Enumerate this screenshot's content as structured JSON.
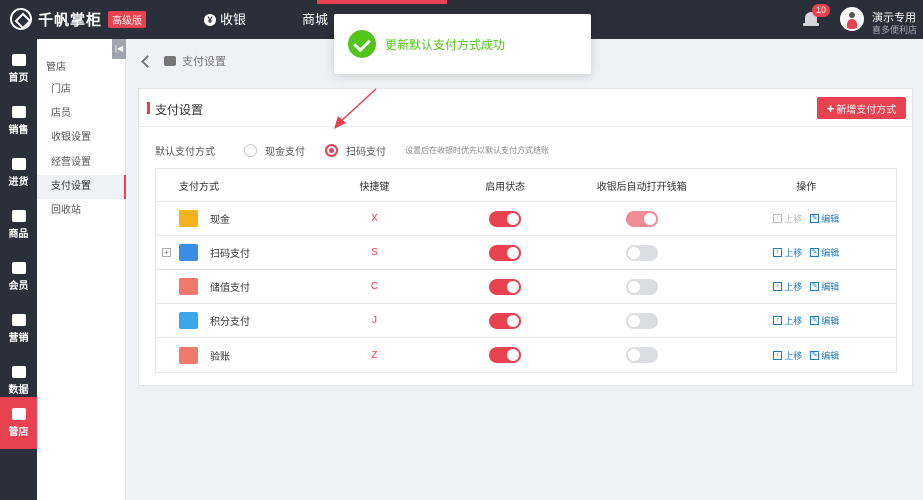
{
  "header": {
    "brand": "千帆掌柜",
    "edition": "高级版",
    "nav": [
      {
        "label": "收银",
        "icon": "yen-icon"
      },
      {
        "label": "商城"
      }
    ],
    "notification_count": "10",
    "user_name": "演示专用",
    "user_store": "喜多便利店"
  },
  "sidebar": {
    "items": [
      {
        "label": "首页"
      },
      {
        "label": "销售"
      },
      {
        "label": "进货"
      },
      {
        "label": "商品"
      },
      {
        "label": "会员"
      },
      {
        "label": "营销"
      },
      {
        "label": "数据"
      },
      {
        "label": "管店"
      }
    ]
  },
  "submenu": {
    "title": "管店",
    "items": [
      "门店",
      "店员",
      "收银设置",
      "经营设置",
      "支付设置",
      "回收站"
    ]
  },
  "breadcrumb": {
    "text": "支付设置"
  },
  "toast": {
    "message": "更新默认支付方式成功"
  },
  "panel": {
    "title": "支付设置",
    "add_button": "新增支付方式",
    "default_label": "默认支付方式",
    "options": [
      "现金支付",
      "扫码支付"
    ],
    "selected_option": "扫码支付",
    "hint": "设置后在收银时优先以默认支付方式结账"
  },
  "table": {
    "headers": [
      "支付方式",
      "快捷键",
      "启用状态",
      "收银后自动打开钱箱",
      "操作"
    ],
    "rows": [
      {
        "name": "现金",
        "key": "X",
        "enabled": true,
        "drawer": true,
        "up": "上移",
        "edit": "编辑",
        "up_disabled": true,
        "icon_color": "#f5b01a"
      },
      {
        "name": "扫码支付",
        "key": "S",
        "enabled": true,
        "drawer": false,
        "up": "上移",
        "edit": "编辑",
        "up_disabled": false,
        "icon_color": "#3a8ee6"
      },
      {
        "name": "储值支付",
        "key": "C",
        "enabled": true,
        "drawer": false,
        "up": "上移",
        "edit": "编辑",
        "up_disabled": false,
        "icon_color": "#f07a6a"
      },
      {
        "name": "积分支付",
        "key": "J",
        "enabled": true,
        "drawer": false,
        "up": "上移",
        "edit": "编辑",
        "up_disabled": false,
        "icon_color": "#3aa7e8"
      },
      {
        "name": "验账",
        "key": "Z",
        "enabled": true,
        "drawer": false,
        "up": "上移",
        "edit": "编辑",
        "up_disabled": false,
        "icon_color": "#f07a6a"
      }
    ]
  },
  "colors": {
    "accent": "#e8414f",
    "success": "#52c41a",
    "link": "#1f7bc1",
    "dark": "#2b2f3a"
  }
}
